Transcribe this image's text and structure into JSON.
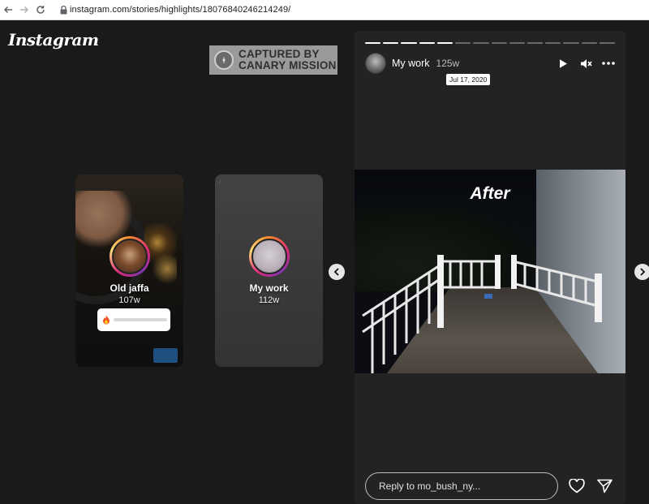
{
  "browser": {
    "back_icon": "arrow-left-icon",
    "forward_icon": "arrow-right-icon",
    "reload_icon": "reload-icon",
    "lock_icon": "lock-icon",
    "url": "instagram.com/stories/highlights/18076840246214249/"
  },
  "app": {
    "logo_text": "Instagram"
  },
  "watermark": {
    "line1": "CAPTURED BY",
    "line2": "CANARY MISSION"
  },
  "highlights": [
    {
      "title": "Old jaffa",
      "age": "107w"
    },
    {
      "title": "My work",
      "age": "112w"
    }
  ],
  "story": {
    "username": "My work",
    "age": "125w",
    "tooltip": "Jul 17, 2020",
    "progress": {
      "total": 14,
      "completed": 5
    },
    "media_caption": "After",
    "reply_placeholder": "Reply to mo_bush_ny...",
    "controls": [
      "play-icon",
      "mute-icon",
      "more-icon"
    ]
  },
  "colors": {
    "background": "#1a1a1a",
    "story_bg": "#232323",
    "ring_gradient": [
      "#f58529",
      "#dd2a7b",
      "#8134af",
      "#feda77"
    ]
  }
}
